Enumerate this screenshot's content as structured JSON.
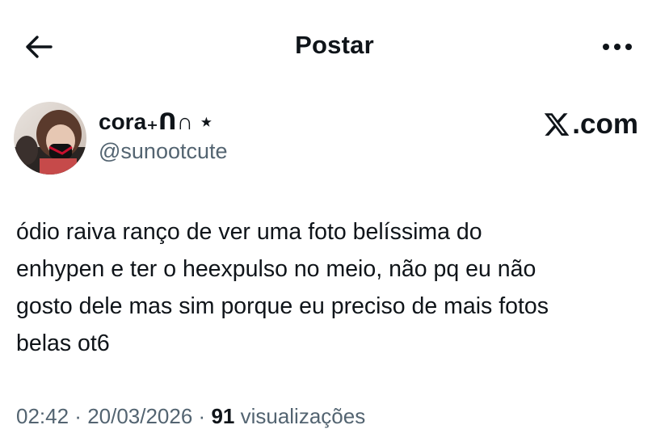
{
  "header": {
    "title": "Postar",
    "back_icon": "arrow-left-icon",
    "more_icon": "more-horizontal-icon"
  },
  "author": {
    "display_name": "cora₊ᑎ∩ ⋆",
    "handle": "@sunootcute",
    "avatar_icon": "avatar"
  },
  "brand": {
    "label": ".com"
  },
  "tweet": {
    "lines": [
      "ódio raiva ranço de ver uma foto belíssima do",
      "enhypen e ter o heexpulso no meio, não pq eu não",
      "gosto dele mas sim porque eu preciso de mais fotos",
      "belas ot6"
    ]
  },
  "meta": {
    "time": "02:42",
    "sep1": " · ",
    "date": "20/03/2026",
    "sep2": " · ",
    "views_count": "91",
    "views_label": " visualizações"
  },
  "colors": {
    "text_primary": "#0f1419",
    "text_secondary": "#536471",
    "background": "#ffffff"
  }
}
